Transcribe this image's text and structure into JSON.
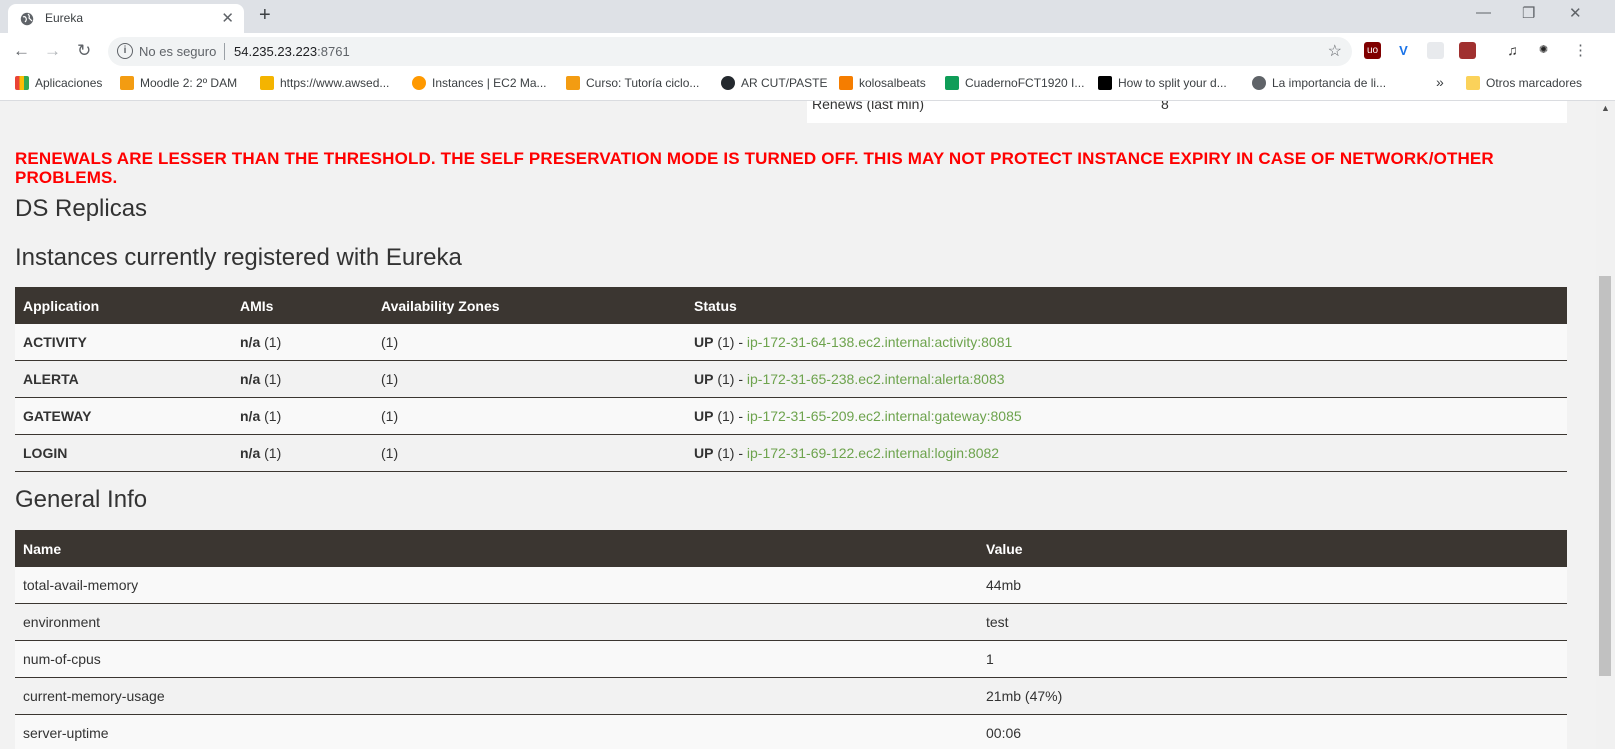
{
  "browser": {
    "tab_title": "Eureka",
    "tab_close": "✕",
    "new_tab": "+",
    "window_controls": [
      "—",
      "❐",
      "✕"
    ],
    "security_label": "No es seguro",
    "url_host": "54.235.23.223",
    "url_port": ":8761",
    "bookmarks": [
      {
        "label": "Aplicaciones",
        "color": "#e8453c"
      },
      {
        "label": "Moodle 2: 2º DAM",
        "color": "#f39c12"
      },
      {
        "label": "https://www.awsed...",
        "color": "#f4b400"
      },
      {
        "label": "Instances | EC2 Ma...",
        "color": "#ff9900"
      },
      {
        "label": "Curso: Tutoría ciclo...",
        "color": "#f39c12"
      },
      {
        "label": "AR CUT/PASTE",
        "color": "#24292e"
      },
      {
        "label": "kolosalbeats",
        "color": "#f57d00"
      },
      {
        "label": "CuadernoFCT1920 I...",
        "color": "#0f9d58"
      },
      {
        "label": "How to split your d...",
        "color": "#000000"
      },
      {
        "label": "La importancia de li...",
        "color": "#5f6368"
      }
    ],
    "bookmarks_overflow": "»",
    "other_bookmarks": "Otros marcadores"
  },
  "top_row": {
    "name": "Renews (last min)",
    "value": "8"
  },
  "warning": "RENEWALS ARE LESSER THAN THE THRESHOLD. THE SELF PRESERVATION MODE IS TURNED OFF. THIS MAY NOT PROTECT INSTANCE EXPIRY IN CASE OF NETWORK/OTHER PROBLEMS.",
  "ds_replicas_title": "DS Replicas",
  "instances": {
    "title": "Instances currently registered with Eureka",
    "headers": [
      "Application",
      "AMIs",
      "Availability Zones",
      "Status"
    ],
    "rows": [
      {
        "app": "ACTIVITY",
        "ami": "n/a",
        "ami_count": "(1)",
        "zones": "(1)",
        "status": "UP",
        "status_count": "(1) -",
        "instance": "ip-172-31-64-138.ec2.internal:activity:8081"
      },
      {
        "app": "ALERTA",
        "ami": "n/a",
        "ami_count": "(1)",
        "zones": "(1)",
        "status": "UP",
        "status_count": "(1) -",
        "instance": "ip-172-31-65-238.ec2.internal:alerta:8083"
      },
      {
        "app": "GATEWAY",
        "ami": "n/a",
        "ami_count": "(1)",
        "zones": "(1)",
        "status": "UP",
        "status_count": "(1) -",
        "instance": "ip-172-31-65-209.ec2.internal:gateway:8085"
      },
      {
        "app": "LOGIN",
        "ami": "n/a",
        "ami_count": "(1)",
        "zones": "(1)",
        "status": "UP",
        "status_count": "(1) -",
        "instance": "ip-172-31-69-122.ec2.internal:login:8082"
      }
    ]
  },
  "general_info": {
    "title": "General Info",
    "headers": [
      "Name",
      "Value"
    ],
    "rows": [
      {
        "name": "total-avail-memory",
        "value": "44mb"
      },
      {
        "name": "environment",
        "value": "test"
      },
      {
        "name": "num-of-cpus",
        "value": "1"
      },
      {
        "name": "current-memory-usage",
        "value": "21mb (47%)"
      },
      {
        "name": "server-uptime",
        "value": "00:06"
      }
    ]
  }
}
